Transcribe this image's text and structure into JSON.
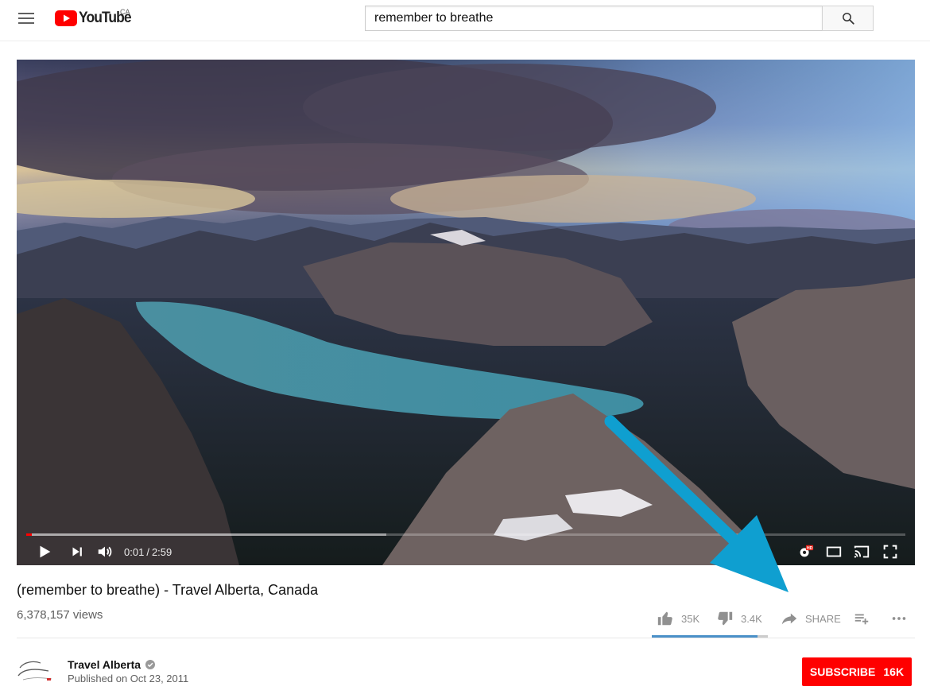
{
  "masthead": {
    "logo_text": "YouTube",
    "country_code": "CA",
    "search_value": "remember to breathe"
  },
  "player": {
    "current_time": "0:01",
    "separator": "/",
    "duration": "2:59",
    "played_fraction": 0.006,
    "buffered_fraction": 0.41
  },
  "video": {
    "title": "(remember to breathe) - Travel Alberta, Canada",
    "views": "6,378,157 views"
  },
  "actions": {
    "likes": "35K",
    "dislikes": "3.4K",
    "share_label": "SHARE",
    "like_fraction": 0.91
  },
  "channel": {
    "name": "Travel Alberta",
    "published": "Published on Oct 23, 2011"
  },
  "subscribe": {
    "label": "SUBSCRIBE",
    "count": "16K"
  },
  "colors": {
    "brand_red": "#ff0000",
    "annotation_arrow": "#0f9fd0"
  },
  "icons": [
    "menu-icon",
    "youtube-logo-icon",
    "search-icon",
    "play-icon",
    "next-icon",
    "volume-icon",
    "settings-hd-icon",
    "theater-mode-icon",
    "cast-icon",
    "fullscreen-icon",
    "thumbs-up-icon",
    "thumbs-down-icon",
    "share-icon",
    "add-to-playlist-icon",
    "more-icon",
    "verified-icon"
  ]
}
